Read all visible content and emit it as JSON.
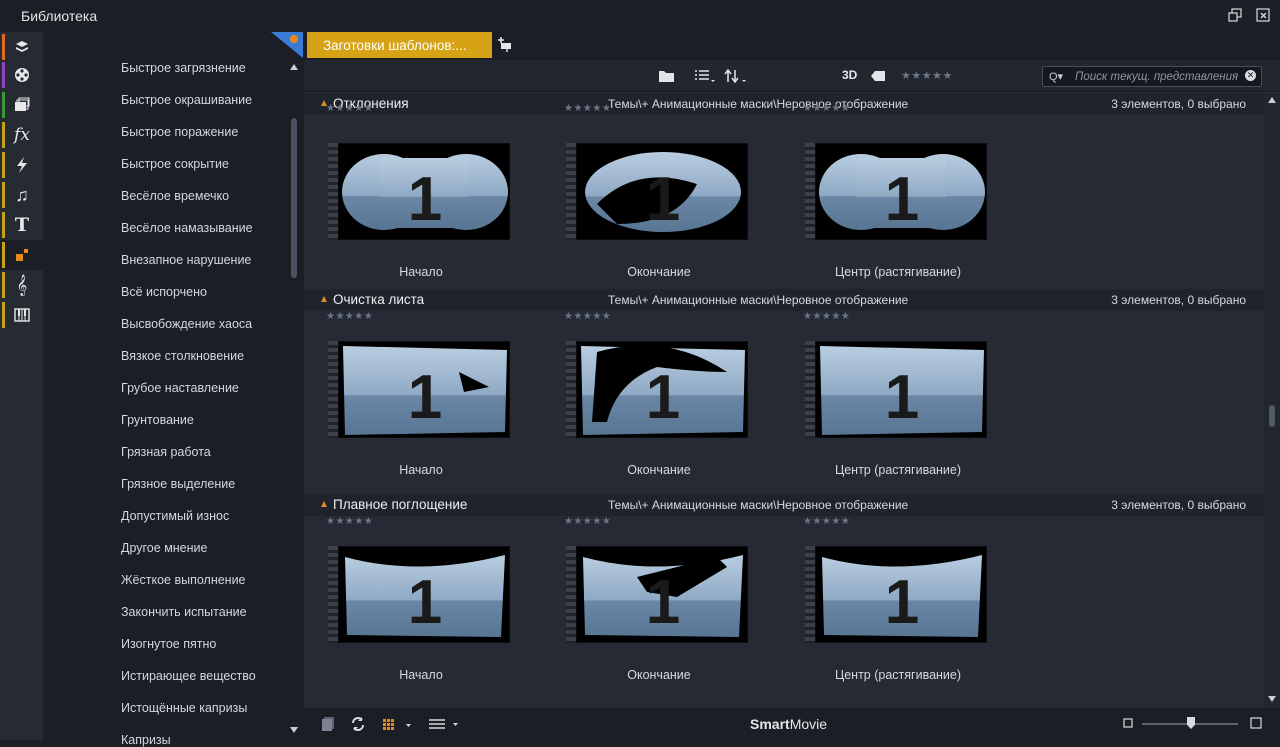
{
  "window": {
    "title": "Библиотека"
  },
  "sidebar_categories": [
    {
      "icon": "layers-icon",
      "stripe": "#e06a1f"
    },
    {
      "icon": "film-reel-icon",
      "stripe": "#8a45c7"
    },
    {
      "icon": "collections-icon",
      "stripe": "#3d9a3a"
    },
    {
      "icon": "fx-icon",
      "stripe": "#c8a31a",
      "glyph": "fx"
    },
    {
      "icon": "lightning-icon",
      "stripe": "#c8a31a"
    },
    {
      "icon": "music-note-icon",
      "stripe": "#c8a31a"
    },
    {
      "icon": "title-t-icon",
      "stripe": "#c8a31a",
      "glyph": "T"
    },
    {
      "icon": "montage-icon",
      "stripe": "#c8a31a",
      "active": true
    },
    {
      "icon": "treble-clef-icon",
      "stripe": "#c8a31a"
    },
    {
      "icon": "keyboard-icon",
      "stripe": "#c8a31a"
    }
  ],
  "tree_items": [
    "Быстрое загрязнение",
    "Быстрое окрашивание",
    "Быстрое поражение",
    "Быстрое сокрытие",
    "Весёлое времечко",
    "Весёлое намазывание",
    "Внезапное нарушение",
    "Всё испорчено",
    "Высвобождение хаоса",
    "Вязкое столкновение",
    "Грубое наставление",
    "Грунтование",
    "Грязная работа",
    "Грязное выделение",
    "Допустимый износ",
    "Другое мнение",
    "Жёсткое выполнение",
    "Закончить испытание",
    "Изогнутое пятно",
    "Истирающее вещество",
    "Истощённые капризы",
    "Капризы"
  ],
  "tabs": {
    "active_label": "Заготовки шаблонов:..."
  },
  "toolbar": {
    "three_d": "3D",
    "rating": "★★★★★",
    "search_placeholder": "Поиск текущ. представления"
  },
  "groups": [
    {
      "name": "Отклонения",
      "path": "Темы\\+ Анимационные маски\\Неровное отображение",
      "count": "3 элементов, 0 выбрано",
      "items": [
        {
          "label": "Начало",
          "rating": "★★★★★"
        },
        {
          "label": "Окончание",
          "rating": "★★★★★"
        },
        {
          "label": "Центр (растягивание)",
          "rating": "★★★★★"
        }
      ]
    },
    {
      "name": "Очистка листа",
      "path": "Темы\\+ Анимационные маски\\Неровное отображение",
      "count": "3 элементов, 0 выбрано",
      "items": [
        {
          "label": "Начало",
          "rating": "★★★★★"
        },
        {
          "label": "Окончание",
          "rating": "★★★★★"
        },
        {
          "label": "Центр (растягивание)",
          "rating": "★★★★★"
        }
      ]
    },
    {
      "name": "Плавное поглощение",
      "path": "Темы\\+ Анимационные маски\\Неровное отображение",
      "count": "3 элементов, 0 выбрано",
      "items": [
        {
          "label": "Начало",
          "rating": "★★★★★"
        },
        {
          "label": "Окончание",
          "rating": "★★★★★"
        },
        {
          "label": "Центр (растягивание)",
          "rating": "★★★★★"
        }
      ]
    }
  ],
  "statusbar": {
    "brand_bold": "Smart",
    "brand_regular": "Movie"
  },
  "colors": {
    "accent_tab": "#d6a316",
    "group_triangle": "#e08a1f"
  }
}
